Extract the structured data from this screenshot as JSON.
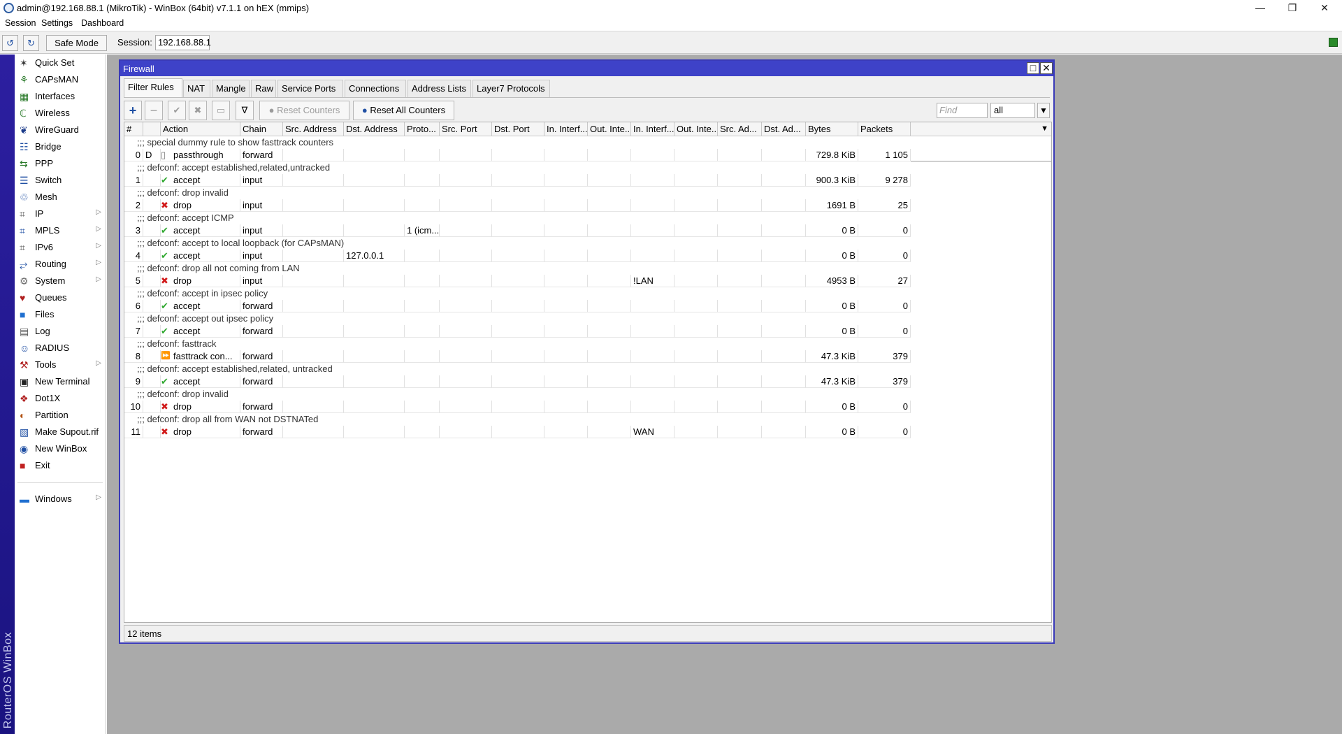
{
  "window": {
    "title": "admin@192.168.88.1 (MikroTik) - WinBox (64bit) v7.1.1 on hEX (mmips)"
  },
  "menubar": {
    "items": [
      "Session",
      "Settings",
      "Dashboard"
    ]
  },
  "toolbar": {
    "safe_mode_label": "Safe Mode",
    "session_label": "Session:",
    "session_value": "192.168.88.1"
  },
  "brand": "RouterOS WinBox",
  "sidebar": {
    "items": [
      {
        "label": "Quick Set",
        "icon": "wand-icon",
        "submenu": false
      },
      {
        "label": "CAPsMAN",
        "icon": "antenna-icon",
        "submenu": false
      },
      {
        "label": "Interfaces",
        "icon": "interfaces-icon",
        "submenu": false
      },
      {
        "label": "Wireless",
        "icon": "wireless-icon",
        "submenu": false
      },
      {
        "label": "WireGuard",
        "icon": "wireguard-icon",
        "submenu": false
      },
      {
        "label": "Bridge",
        "icon": "bridge-icon",
        "submenu": false
      },
      {
        "label": "PPP",
        "icon": "ppp-icon",
        "submenu": false
      },
      {
        "label": "Switch",
        "icon": "switch-icon",
        "submenu": false
      },
      {
        "label": "Mesh",
        "icon": "mesh-icon",
        "submenu": false
      },
      {
        "label": "IP",
        "icon": "ip-icon",
        "submenu": true
      },
      {
        "label": "MPLS",
        "icon": "mpls-icon",
        "submenu": true
      },
      {
        "label": "IPv6",
        "icon": "ipv6-icon",
        "submenu": true
      },
      {
        "label": "Routing",
        "icon": "routing-icon",
        "submenu": true
      },
      {
        "label": "System",
        "icon": "gear-icon",
        "submenu": true
      },
      {
        "label": "Queues",
        "icon": "queues-icon",
        "submenu": false
      },
      {
        "label": "Files",
        "icon": "folder-icon",
        "submenu": false
      },
      {
        "label": "Log",
        "icon": "log-icon",
        "submenu": false
      },
      {
        "label": "RADIUS",
        "icon": "radius-icon",
        "submenu": false
      },
      {
        "label": "Tools",
        "icon": "tools-icon",
        "submenu": true
      },
      {
        "label": "New Terminal",
        "icon": "terminal-icon",
        "submenu": false
      },
      {
        "label": "Dot1X",
        "icon": "dot1x-icon",
        "submenu": false
      },
      {
        "label": "Partition",
        "icon": "partition-icon",
        "submenu": false
      },
      {
        "label": "Make Supout.rif",
        "icon": "supout-icon",
        "submenu": false
      },
      {
        "label": "New WinBox",
        "icon": "winbox-icon",
        "submenu": false
      },
      {
        "label": "Exit",
        "icon": "exit-icon",
        "submenu": false
      }
    ],
    "windows_item": {
      "label": "Windows",
      "icon": "windows-icon",
      "submenu": true
    }
  },
  "firewall": {
    "title": "Firewall",
    "tabs": [
      "Filter Rules",
      "NAT",
      "Mangle",
      "Raw",
      "Service Ports",
      "Connections",
      "Address Lists",
      "Layer7 Protocols"
    ],
    "active_tab": "Filter Rules",
    "toolbar": {
      "reset_counters": "Reset Counters",
      "reset_all_counters": "Reset All Counters",
      "find_placeholder": "Find",
      "filter_value": "all"
    },
    "columns": [
      "#",
      "",
      "Action",
      "Chain",
      "Src. Address",
      "Dst. Address",
      "Proto...",
      "Src. Port",
      "Dst. Port",
      "In. Interf...",
      "Out. Inte...",
      "In. Interf...",
      "Out. Inte...",
      "Src. Ad...",
      "Dst. Ad...",
      "Bytes",
      "Packets"
    ],
    "rules": [
      {
        "comment": ";;; special dummy rule to show fasttrack counters",
        "num": "0",
        "flag": "D",
        "action": "passthrough",
        "action_icon": "passthrough-icon",
        "chain": "forward",
        "src_address": "",
        "dst_address": "",
        "protocol": "",
        "in_interface_list": "",
        "bytes": "729.8 KiB",
        "packets": "1 105"
      },
      {
        "comment": ";;; defconf: accept established,related,untracked",
        "num": "1",
        "flag": "",
        "action": "accept",
        "action_icon": "check-icon",
        "chain": "input",
        "src_address": "",
        "dst_address": "",
        "protocol": "",
        "in_interface_list": "",
        "bytes": "900.3 KiB",
        "packets": "9 278"
      },
      {
        "comment": ";;; defconf: drop invalid",
        "num": "2",
        "flag": "",
        "action": "drop",
        "action_icon": "cross-icon",
        "chain": "input",
        "src_address": "",
        "dst_address": "",
        "protocol": "",
        "in_interface_list": "",
        "bytes": "1691 B",
        "packets": "25"
      },
      {
        "comment": ";;; defconf: accept ICMP",
        "num": "3",
        "flag": "",
        "action": "accept",
        "action_icon": "check-icon",
        "chain": "input",
        "src_address": "",
        "dst_address": "",
        "protocol": "1 (icm...",
        "in_interface_list": "",
        "bytes": "0 B",
        "packets": "0"
      },
      {
        "comment": ";;; defconf: accept to local loopback (for CAPsMAN)",
        "num": "4",
        "flag": "",
        "action": "accept",
        "action_icon": "check-icon",
        "chain": "input",
        "src_address": "",
        "dst_address": "127.0.0.1",
        "protocol": "",
        "in_interface_list": "",
        "bytes": "0 B",
        "packets": "0"
      },
      {
        "comment": ";;; defconf: drop all not coming from LAN",
        "num": "5",
        "flag": "",
        "action": "drop",
        "action_icon": "cross-icon",
        "chain": "input",
        "src_address": "",
        "dst_address": "",
        "protocol": "",
        "in_interface_list": "!LAN",
        "bytes": "4953 B",
        "packets": "27"
      },
      {
        "comment": ";;; defconf: accept in ipsec policy",
        "num": "6",
        "flag": "",
        "action": "accept",
        "action_icon": "check-icon",
        "chain": "forward",
        "src_address": "",
        "dst_address": "",
        "protocol": "",
        "in_interface_list": "",
        "bytes": "0 B",
        "packets": "0"
      },
      {
        "comment": ";;; defconf: accept out ipsec policy",
        "num": "7",
        "flag": "",
        "action": "accept",
        "action_icon": "check-icon",
        "chain": "forward",
        "src_address": "",
        "dst_address": "",
        "protocol": "",
        "in_interface_list": "",
        "bytes": "0 B",
        "packets": "0"
      },
      {
        "comment": ";;; defconf: fasttrack",
        "num": "8",
        "flag": "",
        "action": "fasttrack con...",
        "action_icon": "fasttrack-icon",
        "chain": "forward",
        "src_address": "",
        "dst_address": "",
        "protocol": "",
        "in_interface_list": "",
        "bytes": "47.3 KiB",
        "packets": "379"
      },
      {
        "comment": ";;; defconf: accept established,related, untracked",
        "num": "9",
        "flag": "",
        "action": "accept",
        "action_icon": "check-icon",
        "chain": "forward",
        "src_address": "",
        "dst_address": "",
        "protocol": "",
        "in_interface_list": "",
        "bytes": "47.3 KiB",
        "packets": "379"
      },
      {
        "comment": ";;; defconf: drop invalid",
        "num": "10",
        "flag": "",
        "action": "drop",
        "action_icon": "cross-icon",
        "chain": "forward",
        "src_address": "",
        "dst_address": "",
        "protocol": "",
        "in_interface_list": "",
        "bytes": "0 B",
        "packets": "0"
      },
      {
        "comment": ";;; defconf: drop all from WAN not DSTNATed",
        "num": "11",
        "flag": "",
        "action": "drop",
        "action_icon": "cross-icon",
        "chain": "forward",
        "src_address": "",
        "dst_address": "",
        "protocol": "",
        "in_interface_list": "WAN",
        "bytes": "0 B",
        "packets": "0"
      }
    ],
    "status": "12 items"
  },
  "colors": {
    "brand_bar": "#2c1fa0",
    "window_title": "#3e42c8",
    "workspace": "#aaaaaa",
    "accept": "#2fa82f",
    "drop": "#d11a1a",
    "connected": "#2a8a2a"
  }
}
